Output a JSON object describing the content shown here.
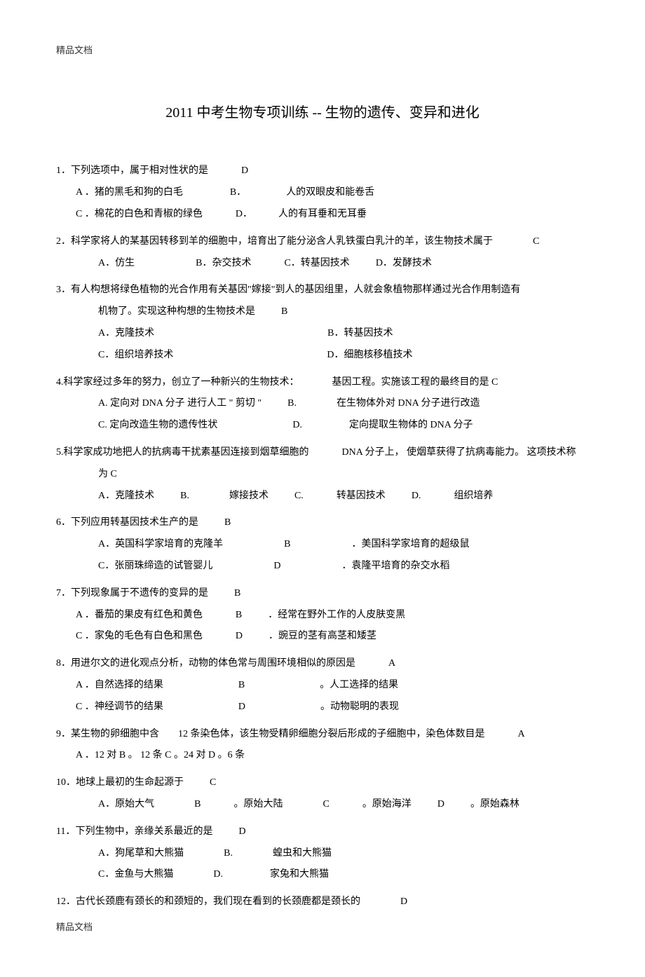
{
  "header": "精品文档",
  "footer": "精品文档",
  "title": "2011 中考生物专项训练 -- 生物的遗传、变异和进化",
  "q1": {
    "stem": "1．下列选项中，属于相对性状的是",
    "ans": "D",
    "a": "A  ．猪的黑毛和狗的白毛",
    "b": "B．",
    "btext": "人的双眼皮和能卷舌",
    "c": "C  ．棉花的白色和青椒的绿色",
    "d": "D．",
    "dtext": "人的有耳垂和无耳垂"
  },
  "q2": {
    "stem": "2．科学家将人的某基因转移到羊的细胞中，培育出了能分泌含人乳铁蛋白乳汁的羊，该生物技术属于",
    "ans": "C",
    "a": "A．仿生",
    "b": "B．杂交技术",
    "c": "C．转基因技术",
    "d": "D．发酵技术"
  },
  "q3": {
    "stem1": "3．有人构想将绿色植物的光合作用有关基因\"嫁接\"到人的基因组里，人就会象植物那样通过光合作用制造有",
    "stem2": "机物了。实现这种构想的生物技术是",
    "ans": "B",
    "a": "A．克隆技术",
    "b": "B．转基因技术",
    "c": "C．组织培养技术",
    "d": "D．细胞核移植技术"
  },
  "q4": {
    "stem": "4.科学家经过多年的努力，创立了一种新兴的生物技术：",
    "stem2": "基因工程。实施该工程的最终目的是 C",
    "a": "A. 定向对 DNA 分子  进行人工 \" 剪切 \"",
    "b": "B.",
    "btext": "在生物体外对 DNA 分子进行改造",
    "c": "C. 定向改造生物的遗传性状",
    "d": "D.",
    "dtext": "定向提取生物体的  DNA 分子"
  },
  "q5": {
    "stem1": "5.科学家成功地把人的抗病毒干扰素基因连接到烟草细胞的",
    "stem2": "DNA 分子上， 使烟草获得了抗病毒能力。 这项技术称",
    "stem3": "为 C",
    "a": "A．克隆技术",
    "b": "B.",
    "btext": "嫁接技术",
    "c": "C.",
    "ctext": "转基因技术",
    "d": "D.",
    "dtext": "组织培养"
  },
  "q6": {
    "stem": "6．下列应用转基因技术生产的是",
    "ans": "B",
    "a": "A．英国科学家培育的克隆羊",
    "b": "B",
    "btext": "．美国科学家培育的超级鼠",
    "c": "C．张丽珠缔造的试管婴儿",
    "d": "D",
    "dtext": "．袁隆平培育的杂交水稻"
  },
  "q7": {
    "stem": "7．下列现象属于不遗传的变异的是",
    "ans": "B",
    "a": "A  ．番茄的果皮有红色和黄色",
    "b": "B",
    "btext": "．经常在野外工作的人皮肤变黑",
    "c": "C  ．家兔的毛色有白色和黑色",
    "d": "D",
    "dtext": "．豌豆的茎有高茎和矮茎"
  },
  "q8": {
    "stem": "8．用进尔文的进化观点分析，动物的体色常与周围环境相似的原因是",
    "ans": "A",
    "a": "A  ．自然选择的结果",
    "b": "B",
    "btext": "。人工选择的结果",
    "c": "C  ．神经调节的结果",
    "d": "D",
    "dtext": "。动物聪明的表现"
  },
  "q9": {
    "stem1": "9．某生物的卵细胞中含",
    "stem2": "12 条染色体，该生物受精卵细胞分裂后形成的子细胞中，染色体数目是",
    "ans": "A",
    "opts": "A  ．12 对  B  。 12  条  C  。24 对   D  。6 条"
  },
  "q10": {
    "stem": "10．地球上最初的生命起源于",
    "ans": "C",
    "a": "A．原始大气",
    "b": "B",
    "btext": "。原始大陆",
    "c": "C",
    "ctext": "。原始海洋",
    "d": "D",
    "dtext": "。原始森林"
  },
  "q11": {
    "stem": "11．下列生物中，亲缘关系最近的是",
    "ans": "D",
    "a": "A．狗尾草和大熊猫",
    "b": "B.",
    "btext": "蝗虫和大熊猫",
    "c": "C．金鱼与大熊猫",
    "d": "D.",
    "dtext": "家兔和大熊猫"
  },
  "q12": {
    "stem": "12．古代长颈鹿有颈长的和颈短的，我们现在看到的长颈鹿都是颈长的",
    "ans": "D"
  }
}
